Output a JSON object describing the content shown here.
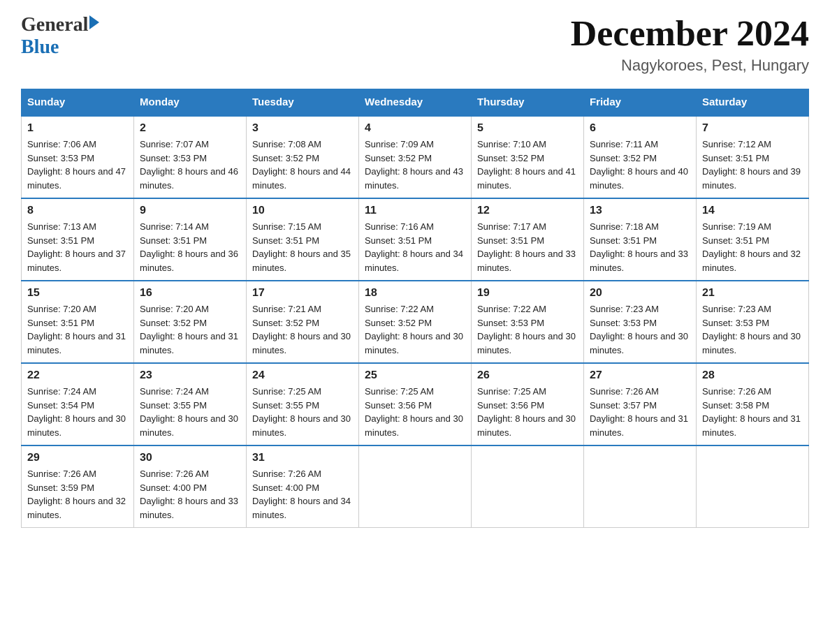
{
  "header": {
    "logo_general": "General",
    "logo_blue": "Blue",
    "title": "December 2024",
    "subtitle": "Nagykoroes, Pest, Hungary"
  },
  "columns": [
    "Sunday",
    "Monday",
    "Tuesday",
    "Wednesday",
    "Thursday",
    "Friday",
    "Saturday"
  ],
  "weeks": [
    [
      {
        "day": "1",
        "sunrise": "7:06 AM",
        "sunset": "3:53 PM",
        "daylight": "8 hours and 47 minutes."
      },
      {
        "day": "2",
        "sunrise": "7:07 AM",
        "sunset": "3:53 PM",
        "daylight": "8 hours and 46 minutes."
      },
      {
        "day": "3",
        "sunrise": "7:08 AM",
        "sunset": "3:52 PM",
        "daylight": "8 hours and 44 minutes."
      },
      {
        "day": "4",
        "sunrise": "7:09 AM",
        "sunset": "3:52 PM",
        "daylight": "8 hours and 43 minutes."
      },
      {
        "day": "5",
        "sunrise": "7:10 AM",
        "sunset": "3:52 PM",
        "daylight": "8 hours and 41 minutes."
      },
      {
        "day": "6",
        "sunrise": "7:11 AM",
        "sunset": "3:52 PM",
        "daylight": "8 hours and 40 minutes."
      },
      {
        "day": "7",
        "sunrise": "7:12 AM",
        "sunset": "3:51 PM",
        "daylight": "8 hours and 39 minutes."
      }
    ],
    [
      {
        "day": "8",
        "sunrise": "7:13 AM",
        "sunset": "3:51 PM",
        "daylight": "8 hours and 37 minutes."
      },
      {
        "day": "9",
        "sunrise": "7:14 AM",
        "sunset": "3:51 PM",
        "daylight": "8 hours and 36 minutes."
      },
      {
        "day": "10",
        "sunrise": "7:15 AM",
        "sunset": "3:51 PM",
        "daylight": "8 hours and 35 minutes."
      },
      {
        "day": "11",
        "sunrise": "7:16 AM",
        "sunset": "3:51 PM",
        "daylight": "8 hours and 34 minutes."
      },
      {
        "day": "12",
        "sunrise": "7:17 AM",
        "sunset": "3:51 PM",
        "daylight": "8 hours and 33 minutes."
      },
      {
        "day": "13",
        "sunrise": "7:18 AM",
        "sunset": "3:51 PM",
        "daylight": "8 hours and 33 minutes."
      },
      {
        "day": "14",
        "sunrise": "7:19 AM",
        "sunset": "3:51 PM",
        "daylight": "8 hours and 32 minutes."
      }
    ],
    [
      {
        "day": "15",
        "sunrise": "7:20 AM",
        "sunset": "3:51 PM",
        "daylight": "8 hours and 31 minutes."
      },
      {
        "day": "16",
        "sunrise": "7:20 AM",
        "sunset": "3:52 PM",
        "daylight": "8 hours and 31 minutes."
      },
      {
        "day": "17",
        "sunrise": "7:21 AM",
        "sunset": "3:52 PM",
        "daylight": "8 hours and 30 minutes."
      },
      {
        "day": "18",
        "sunrise": "7:22 AM",
        "sunset": "3:52 PM",
        "daylight": "8 hours and 30 minutes."
      },
      {
        "day": "19",
        "sunrise": "7:22 AM",
        "sunset": "3:53 PM",
        "daylight": "8 hours and 30 minutes."
      },
      {
        "day": "20",
        "sunrise": "7:23 AM",
        "sunset": "3:53 PM",
        "daylight": "8 hours and 30 minutes."
      },
      {
        "day": "21",
        "sunrise": "7:23 AM",
        "sunset": "3:53 PM",
        "daylight": "8 hours and 30 minutes."
      }
    ],
    [
      {
        "day": "22",
        "sunrise": "7:24 AM",
        "sunset": "3:54 PM",
        "daylight": "8 hours and 30 minutes."
      },
      {
        "day": "23",
        "sunrise": "7:24 AM",
        "sunset": "3:55 PM",
        "daylight": "8 hours and 30 minutes."
      },
      {
        "day": "24",
        "sunrise": "7:25 AM",
        "sunset": "3:55 PM",
        "daylight": "8 hours and 30 minutes."
      },
      {
        "day": "25",
        "sunrise": "7:25 AM",
        "sunset": "3:56 PM",
        "daylight": "8 hours and 30 minutes."
      },
      {
        "day": "26",
        "sunrise": "7:25 AM",
        "sunset": "3:56 PM",
        "daylight": "8 hours and 30 minutes."
      },
      {
        "day": "27",
        "sunrise": "7:26 AM",
        "sunset": "3:57 PM",
        "daylight": "8 hours and 31 minutes."
      },
      {
        "day": "28",
        "sunrise": "7:26 AM",
        "sunset": "3:58 PM",
        "daylight": "8 hours and 31 minutes."
      }
    ],
    [
      {
        "day": "29",
        "sunrise": "7:26 AM",
        "sunset": "3:59 PM",
        "daylight": "8 hours and 32 minutes."
      },
      {
        "day": "30",
        "sunrise": "7:26 AM",
        "sunset": "4:00 PM",
        "daylight": "8 hours and 33 minutes."
      },
      {
        "day": "31",
        "sunrise": "7:26 AM",
        "sunset": "4:00 PM",
        "daylight": "8 hours and 34 minutes."
      },
      null,
      null,
      null,
      null
    ]
  ],
  "labels": {
    "sunrise_prefix": "Sunrise: ",
    "sunset_prefix": "Sunset: ",
    "daylight_prefix": "Daylight: "
  }
}
